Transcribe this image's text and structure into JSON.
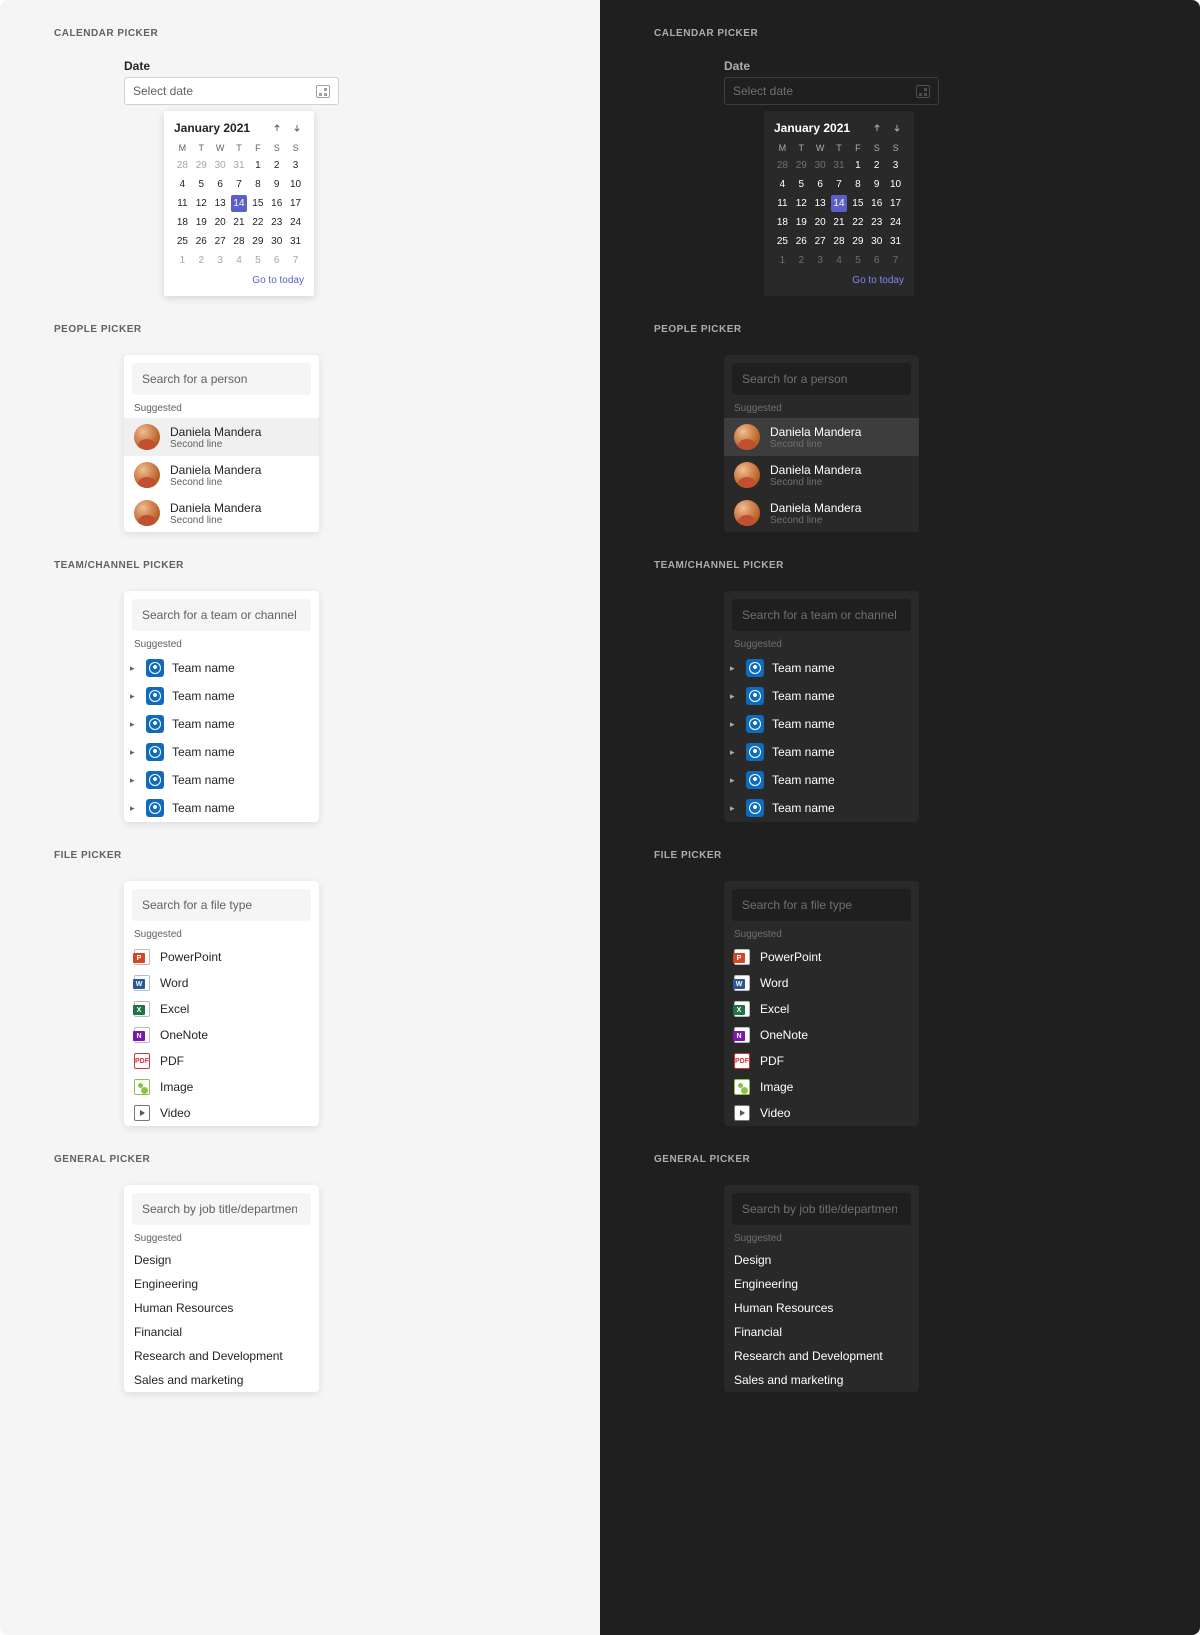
{
  "sections": {
    "calendar": "CALENDAR PICKER",
    "people": "PEOPLE PICKER",
    "team": "TEAM/CHANNEL PICKER",
    "file": "FILE PICKER",
    "general": "GENERAL PICKER"
  },
  "calendar": {
    "label": "Date",
    "placeholder": "Select date",
    "month": "January 2021",
    "dow": [
      "M",
      "T",
      "W",
      "T",
      "F",
      "S",
      "S"
    ],
    "rows": [
      [
        {
          "d": 28,
          "oth": true
        },
        {
          "d": 29,
          "oth": true
        },
        {
          "d": 30,
          "oth": true
        },
        {
          "d": 31,
          "oth": true
        },
        {
          "d": 1
        },
        {
          "d": 2
        },
        {
          "d": 3
        }
      ],
      [
        {
          "d": 4
        },
        {
          "d": 5
        },
        {
          "d": 6
        },
        {
          "d": 7
        },
        {
          "d": 8
        },
        {
          "d": 9
        },
        {
          "d": 10
        }
      ],
      [
        {
          "d": 11
        },
        {
          "d": 12
        },
        {
          "d": 13
        },
        {
          "d": 14,
          "sel": true
        },
        {
          "d": 15
        },
        {
          "d": 16
        },
        {
          "d": 17
        }
      ],
      [
        {
          "d": 18
        },
        {
          "d": 19
        },
        {
          "d": 20
        },
        {
          "d": 21
        },
        {
          "d": 22
        },
        {
          "d": 23
        },
        {
          "d": 24
        }
      ],
      [
        {
          "d": 25
        },
        {
          "d": 26
        },
        {
          "d": 27
        },
        {
          "d": 28
        },
        {
          "d": 29
        },
        {
          "d": 30
        },
        {
          "d": 31
        }
      ],
      [
        {
          "d": 1,
          "oth": true
        },
        {
          "d": 2,
          "oth": true
        },
        {
          "d": 3,
          "oth": true
        },
        {
          "d": 4,
          "oth": true
        },
        {
          "d": 5,
          "oth": true
        },
        {
          "d": 6,
          "oth": true
        },
        {
          "d": 7,
          "oth": true
        }
      ]
    ],
    "goToday": "Go to today"
  },
  "suggested_label": "Suggested",
  "people": {
    "placeholder": "Search for a person",
    "items": [
      {
        "name": "Daniela Mandera",
        "sub": "Second line",
        "hl": true
      },
      {
        "name": "Daniela Mandera",
        "sub": "Second line"
      },
      {
        "name": "Daniela Mandera",
        "sub": "Second line"
      }
    ]
  },
  "team": {
    "placeholder": "Search for a team or channel",
    "items": [
      "Team name",
      "Team name",
      "Team name",
      "Team name",
      "Team name",
      "Team name"
    ]
  },
  "file": {
    "placeholder": "Search for a file type",
    "items": [
      {
        "label": "PowerPoint",
        "type": "ppt"
      },
      {
        "label": "Word",
        "type": "word"
      },
      {
        "label": "Excel",
        "type": "xls"
      },
      {
        "label": "OneNote",
        "type": "one"
      },
      {
        "label": "PDF",
        "type": "pdf"
      },
      {
        "label": "Image",
        "type": "img"
      },
      {
        "label": "Video",
        "type": "vid"
      }
    ]
  },
  "general": {
    "placeholder": "Search by job title/department",
    "items": [
      "Design",
      "Engineering",
      "Human Resources",
      "Financial",
      "Research and Development",
      "Sales and marketing"
    ]
  }
}
